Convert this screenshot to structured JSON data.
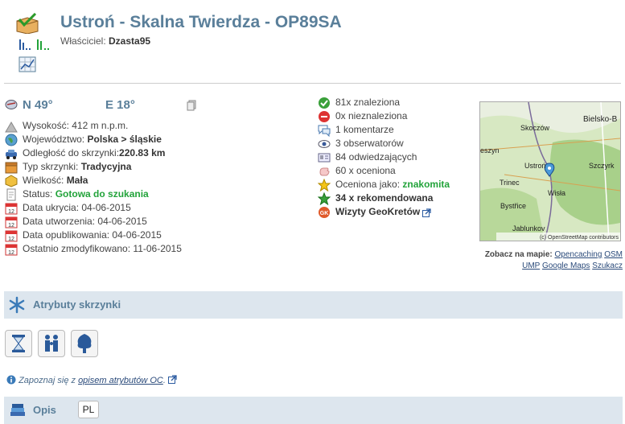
{
  "header": {
    "title": "Ustroń - Skalna Twierdza - OP89SA",
    "owner_label": "Właściciel:",
    "owner_name": "Dzasta95"
  },
  "coords": {
    "lat": "N 49°",
    "lon": "E 18°"
  },
  "details": {
    "altitude_label": "Wysokość:",
    "altitude": "412 m n.p.m.",
    "region_label": "Województwo:",
    "region": "Polska > śląskie",
    "distance_label": "Odległość do skrzynki:",
    "distance": "220.83 km",
    "type_label": "Typ skrzynki:",
    "type": "Tradycyjna",
    "size_label": "Wielkość:",
    "size": "Mała",
    "status_label": "Status:",
    "status": "Gotowa do szukania",
    "hidden_label": "Data ukrycia:",
    "hidden": "04-06-2015",
    "created_label": "Data utworzenia:",
    "created": "04-06-2015",
    "published_label": "Data opublikowania:",
    "published": "04-06-2015",
    "modified_label": "Ostatnio zmodyfikowano:",
    "modified": "11-06-2015"
  },
  "stats": {
    "found": "81x znaleziona",
    "not_found": "0x nieznaleziona",
    "comments": "1 komentarze",
    "watchers": "3 obserwatorów",
    "visitors": "84 odwiedzających",
    "ratings": "60 x oceniona",
    "rated_label": "Oceniona jako:",
    "rated": "znakomita",
    "recommended": "34 x rekomendowana",
    "geokrets": "Wizyty GeoKretów"
  },
  "map": {
    "labels": [
      "Bielsko-B",
      "Skoczów",
      "eszyn",
      "Ustroń",
      "Szczyrk",
      "Trinec",
      "Wisła",
      "Bystřice",
      "Jablunkov"
    ],
    "attribution": "(c) OpenStreetMap contributors",
    "see_on_map": "Zobacz na mapie:",
    "links": [
      "Opencaching",
      "OSM",
      "UMP",
      "Google Maps",
      "Szukacz"
    ]
  },
  "attributes": {
    "title": "Atrybuty skrzynki",
    "icons": [
      "hourglass-icon",
      "family-icon",
      "tree-icon"
    ],
    "note_prefix": "Zapoznaj się z",
    "note_link": "opisem atrybutów OC",
    "note_suffix": "."
  },
  "description": {
    "title": "Opis",
    "lang": "PL"
  },
  "colors": {
    "accent": "#5a7f9a",
    "green": "#22a33a",
    "section_bg": "#dde6ee"
  }
}
